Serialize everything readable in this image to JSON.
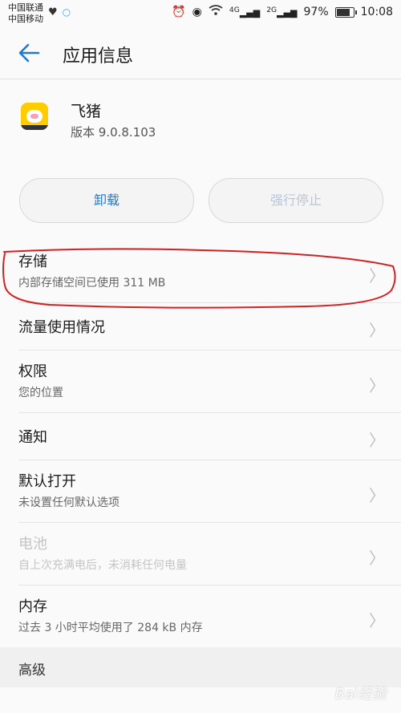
{
  "statusbar": {
    "carrier1": "中国联通",
    "carrier2": "中国移动",
    "network1": "4G",
    "network2": "2G",
    "battery": "97%",
    "time": "10:08"
  },
  "appbar": {
    "title": "应用信息"
  },
  "app": {
    "name": "飞猪",
    "version": "版本 9.0.8.103"
  },
  "buttons": {
    "uninstall": "卸载",
    "force_stop": "强行停止"
  },
  "list": [
    {
      "title": "存储",
      "subtitle": "内部存储空间已使用 311 MB"
    },
    {
      "title": "流量使用情况",
      "subtitle": ""
    },
    {
      "title": "权限",
      "subtitle": "您的位置"
    },
    {
      "title": "通知",
      "subtitle": ""
    },
    {
      "title": "默认打开",
      "subtitle": "未设置任何默认选项"
    },
    {
      "title": "电池",
      "subtitle": "自上次充满电后，未消耗任何电量"
    },
    {
      "title": "内存",
      "subtitle": "过去 3 小时平均使用了 284 kB 内存"
    }
  ],
  "section": {
    "advanced": "高级"
  },
  "watermark": "Bai经验",
  "colors": {
    "accent": "#1e7ad6",
    "highlight": "#d42020"
  }
}
